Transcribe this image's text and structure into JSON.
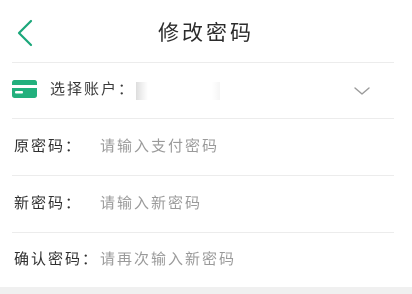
{
  "header": {
    "title": "修改密码",
    "back_icon": "chevron-left-icon",
    "accent_color": "#1aa77a"
  },
  "account": {
    "label": "选择账户：",
    "icon": "credit-card-icon",
    "value": "",
    "dropdown_icon": "chevron-down-icon"
  },
  "fields": {
    "old_password": {
      "label": "原密码：",
      "placeholder": "请输入支付密码"
    },
    "new_password": {
      "label": "新密码：",
      "placeholder": "请输入新密码"
    },
    "confirm_password": {
      "label": "确认密码：",
      "placeholder": "请再次输入新密码"
    }
  }
}
